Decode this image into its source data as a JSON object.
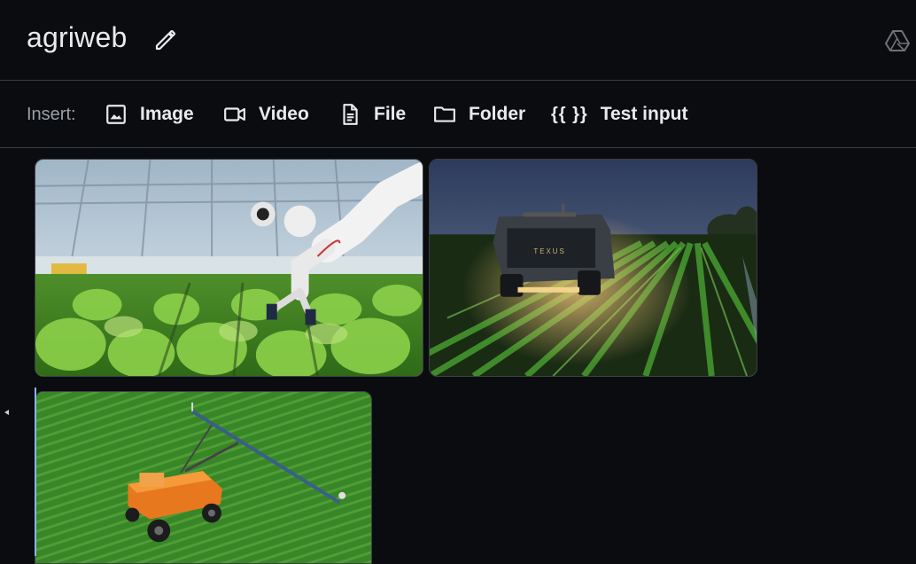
{
  "header": {
    "title": "agriweb",
    "edit_icon": "pencil-icon",
    "drive_icon": "drive-icon"
  },
  "toolbar": {
    "insert_label": "Insert:",
    "buttons": [
      {
        "label": "Image",
        "icon": "image-icon"
      },
      {
        "label": "Video",
        "icon": "video-icon"
      },
      {
        "label": "File",
        "icon": "file-icon"
      },
      {
        "label": "Folder",
        "icon": "folder-icon"
      },
      {
        "label": "Test input",
        "icon": "braces-icon",
        "glyph": "{{ }}"
      }
    ]
  },
  "gallery": {
    "images": [
      {
        "subject": "robotic arm harvesting lettuce in greenhouse"
      },
      {
        "subject": "autonomous vehicle in field at dusk",
        "vehicle_text": "TEXUS"
      },
      {
        "subject": "orange field robot with sprayer boom"
      }
    ]
  },
  "colors": {
    "background": "#0b0c10",
    "text": "#e8eaed",
    "muted": "#9aa0a6",
    "divider": "#3a3d42",
    "selection": "#8ab4f8"
  }
}
